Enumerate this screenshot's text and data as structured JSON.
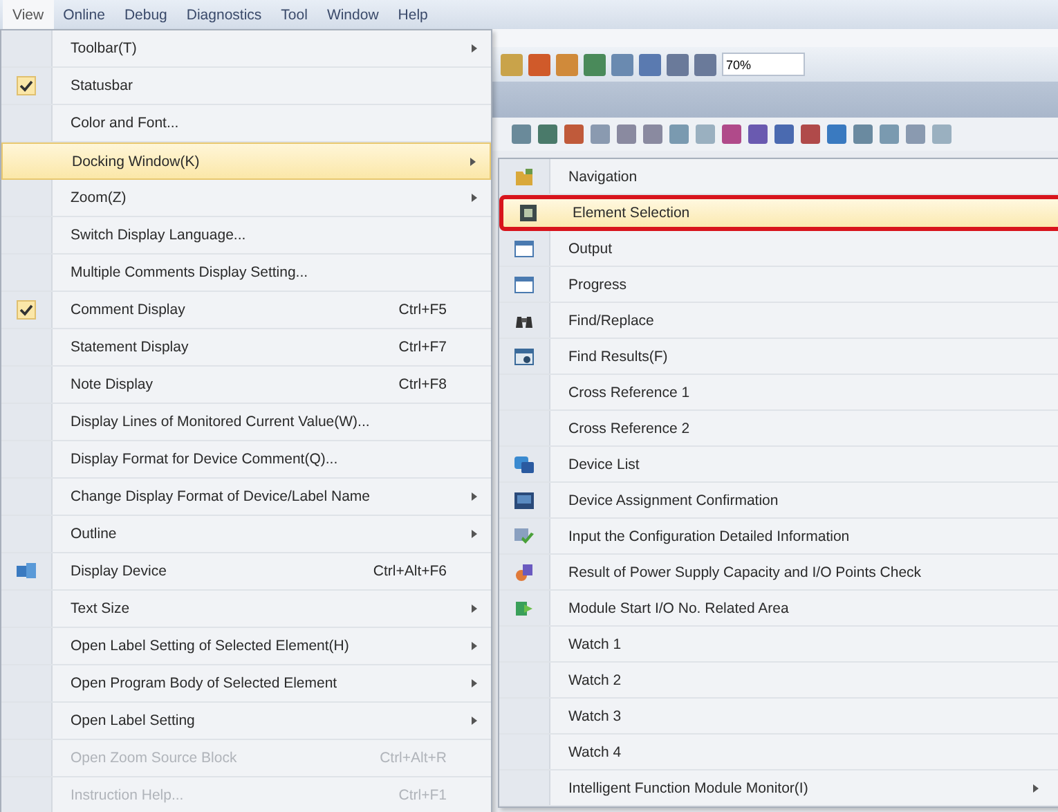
{
  "menu_bar": [
    {
      "label": "View",
      "selected": true
    },
    {
      "label": "Online",
      "selected": false
    },
    {
      "label": "Debug",
      "selected": false
    },
    {
      "label": "Diagnostics",
      "selected": false
    },
    {
      "label": "Tool",
      "selected": false
    },
    {
      "label": "Window",
      "selected": false
    },
    {
      "label": "Help",
      "selected": false
    }
  ],
  "toolbar": {
    "zoom_field": "70%"
  },
  "view_menu": [
    {
      "label": "Toolbar(T)",
      "kind": "plain",
      "checked": false,
      "submenu": true,
      "disabled": false,
      "selected": false
    },
    {
      "label": "Statusbar",
      "kind": "plain",
      "checked": true,
      "submenu": false,
      "disabled": false,
      "selected": false
    },
    {
      "label": "Color and Font...",
      "kind": "plain",
      "checked": false,
      "submenu": false,
      "disabled": false,
      "selected": false
    },
    {
      "label": "Docking Window(K)",
      "kind": "plain",
      "checked": false,
      "submenu": true,
      "disabled": false,
      "selected": true
    },
    {
      "label": "Zoom(Z)",
      "kind": "plain",
      "checked": false,
      "submenu": true,
      "disabled": false,
      "selected": false
    },
    {
      "label": "Switch Display Language...",
      "kind": "plain",
      "checked": false,
      "submenu": false,
      "disabled": false,
      "selected": false
    },
    {
      "label": "Multiple Comments Display Setting...",
      "kind": "plain",
      "checked": false,
      "submenu": false,
      "disabled": false,
      "selected": false
    },
    {
      "label": "Comment Display",
      "shortcut": "Ctrl+F5",
      "kind": "plain",
      "checked": true,
      "submenu": false,
      "disabled": false,
      "selected": false
    },
    {
      "label": "Statement Display",
      "shortcut": "Ctrl+F7",
      "kind": "plain",
      "checked": false,
      "submenu": false,
      "disabled": false,
      "selected": false
    },
    {
      "label": "Note Display",
      "shortcut": "Ctrl+F8",
      "kind": "plain",
      "checked": false,
      "submenu": false,
      "disabled": false,
      "selected": false
    },
    {
      "label": "Display Lines of Monitored Current Value(W)...",
      "kind": "plain",
      "checked": false,
      "submenu": false,
      "disabled": false,
      "selected": false
    },
    {
      "label": "Display Format for Device Comment(Q)...",
      "kind": "plain",
      "checked": false,
      "submenu": false,
      "disabled": false,
      "selected": false
    },
    {
      "label": "Change Display Format of Device/Label Name",
      "kind": "plain",
      "checked": false,
      "submenu": true,
      "disabled": false,
      "selected": false
    },
    {
      "label": "Outline",
      "kind": "plain",
      "checked": false,
      "submenu": true,
      "disabled": false,
      "selected": false
    },
    {
      "label": "Display Device",
      "shortcut": "Ctrl+Alt+F6",
      "kind": "device",
      "checked": false,
      "submenu": false,
      "disabled": false,
      "selected": false
    },
    {
      "label": "Text Size",
      "kind": "plain",
      "checked": false,
      "submenu": true,
      "disabled": false,
      "selected": false
    },
    {
      "label": "Open Label Setting of Selected Element(H)",
      "kind": "plain",
      "checked": false,
      "submenu": true,
      "disabled": false,
      "selected": false
    },
    {
      "label": "Open Program Body of Selected Element",
      "kind": "plain",
      "checked": false,
      "submenu": true,
      "disabled": false,
      "selected": false
    },
    {
      "label": "Open Label Setting",
      "kind": "plain",
      "checked": false,
      "submenu": true,
      "disabled": false,
      "selected": false
    },
    {
      "label": "Open Zoom Source Block",
      "shortcut": "Ctrl+Alt+R",
      "kind": "plain",
      "checked": false,
      "submenu": false,
      "disabled": true,
      "selected": false
    },
    {
      "label": "Instruction Help...",
      "shortcut": "Ctrl+F1",
      "kind": "plain",
      "checked": false,
      "submenu": false,
      "disabled": true,
      "selected": false
    }
  ],
  "docking_submenu": [
    {
      "label": "Navigation",
      "kind": "tree",
      "submenu": false,
      "selected": false
    },
    {
      "label": "Element Selection",
      "kind": "element",
      "submenu": false,
      "selected": true
    },
    {
      "label": "Output",
      "kind": "window",
      "submenu": false,
      "selected": false
    },
    {
      "label": "Progress",
      "kind": "window",
      "submenu": false,
      "selected": false
    },
    {
      "label": "Find/Replace",
      "kind": "binoculars",
      "submenu": false,
      "selected": false
    },
    {
      "label": "Find Results(F)",
      "kind": "results",
      "submenu": false,
      "selected": false
    },
    {
      "label": "Cross Reference 1",
      "kind": "plain",
      "submenu": false,
      "selected": false
    },
    {
      "label": "Cross Reference 2",
      "kind": "plain",
      "submenu": false,
      "selected": false
    },
    {
      "label": "Device List",
      "kind": "list",
      "submenu": false,
      "selected": false
    },
    {
      "label": "Device Assignment Confirmation",
      "kind": "screen",
      "submenu": false,
      "selected": false
    },
    {
      "label": "Input the Configuration Detailed Information",
      "kind": "check",
      "submenu": false,
      "selected": false
    },
    {
      "label": "Result of Power Supply Capacity and I/O Points Check",
      "kind": "power",
      "submenu": false,
      "selected": false
    },
    {
      "label": "Module Start I/O No. Related Area",
      "kind": "module",
      "submenu": false,
      "selected": false
    },
    {
      "label": "Watch 1",
      "kind": "plain",
      "submenu": false,
      "selected": false
    },
    {
      "label": "Watch 2",
      "kind": "plain",
      "submenu": false,
      "selected": false
    },
    {
      "label": "Watch 3",
      "kind": "plain",
      "submenu": false,
      "selected": false
    },
    {
      "label": "Watch 4",
      "kind": "plain",
      "submenu": false,
      "selected": false
    },
    {
      "label": "Intelligent Function Module Monitor(I)",
      "kind": "plain",
      "submenu": true,
      "selected": false
    }
  ]
}
